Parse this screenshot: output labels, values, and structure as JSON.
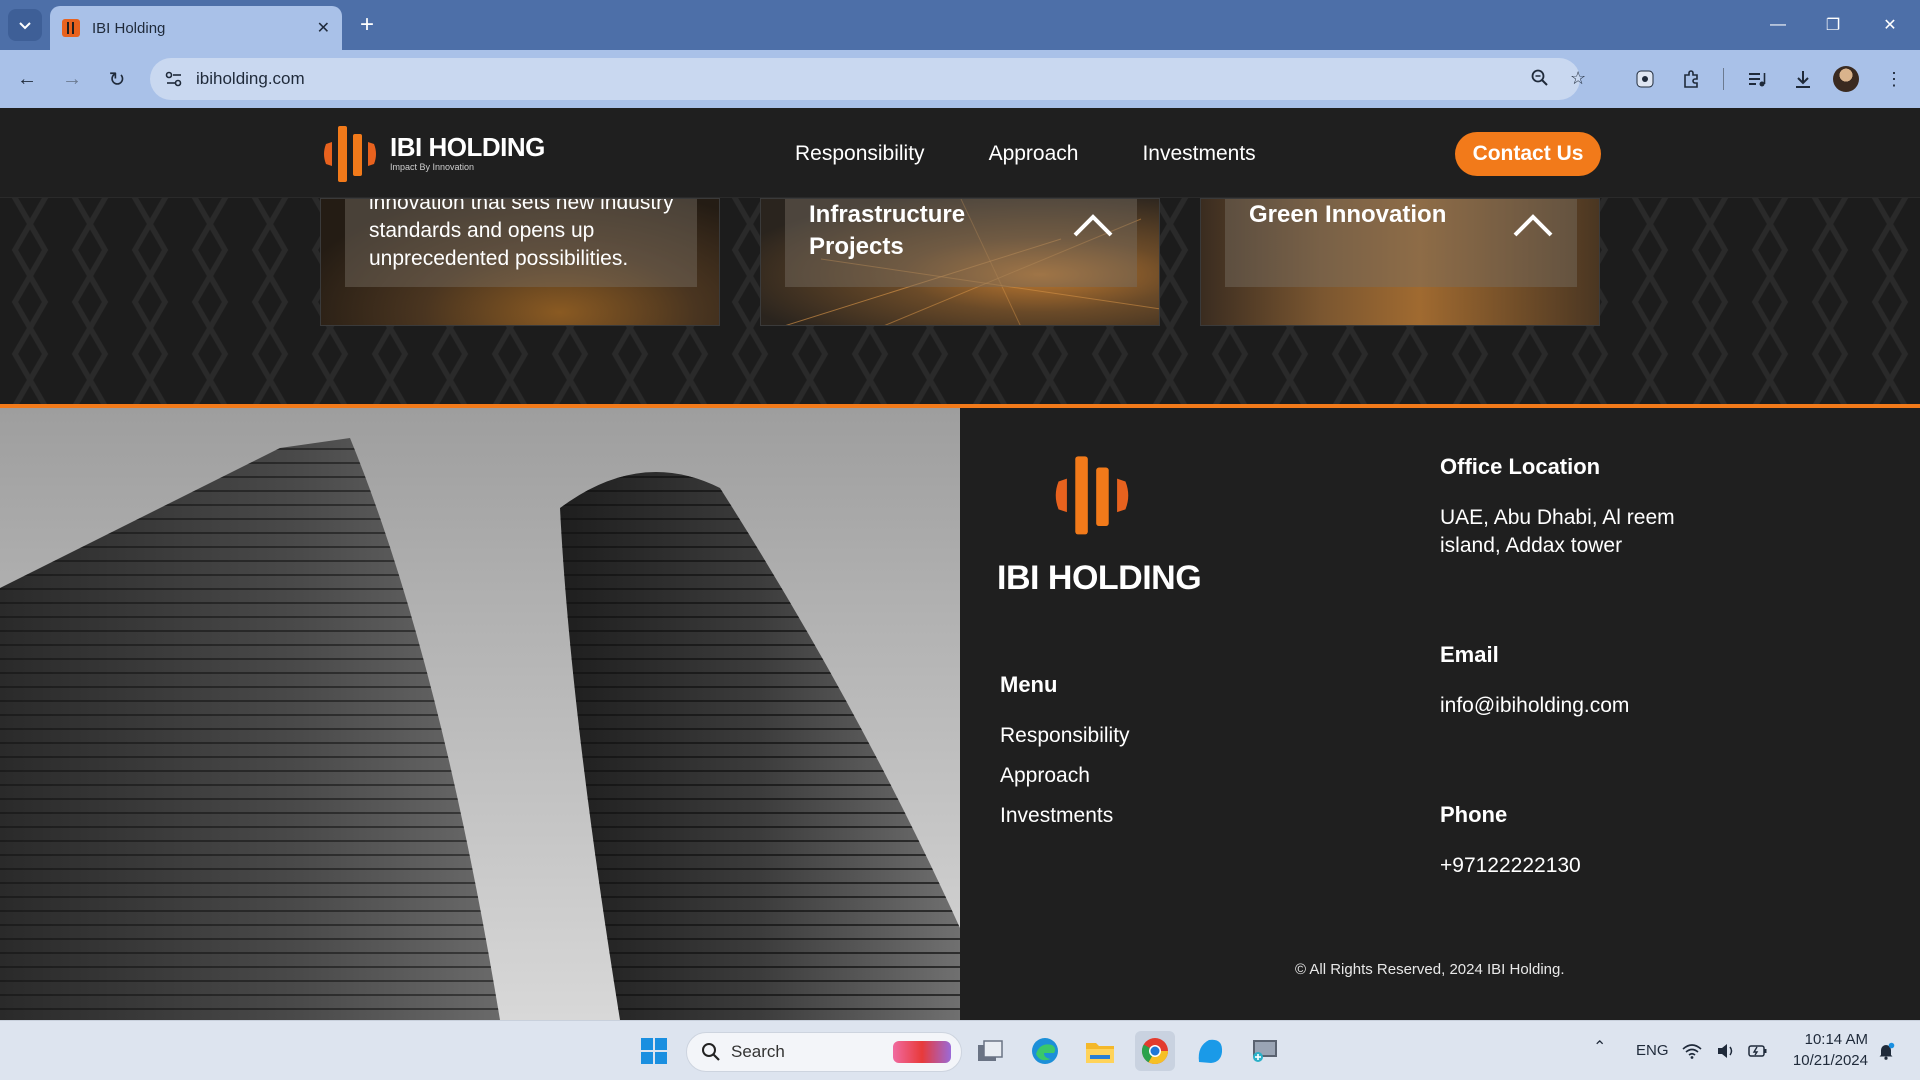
{
  "browser": {
    "tab_title": "IBI Holding",
    "url": "ibiholding.com"
  },
  "site": {
    "logo_name": "IBI HOLDING",
    "logo_tagline": "Impact By Innovation",
    "nav": [
      "Responsibility",
      "Approach",
      "Investments"
    ],
    "contact_label": "Contact Us",
    "brand_color": "#f27a1a"
  },
  "cards": [
    {
      "text": "innovation that sets new industry standards and opens up unprecedented possibilities."
    },
    {
      "title": "Infrastructure Projects"
    },
    {
      "title": "Green Innovation"
    }
  ],
  "footer": {
    "logo_name": "IBI HOLDING",
    "menu_heading": "Menu",
    "menu_items": [
      "Responsibility",
      "Approach",
      "Investments"
    ],
    "office_heading": "Office Location",
    "office_value": "UAE, Abu Dhabi, Al reem island, Addax tower",
    "email_heading": "Email",
    "email_value": "info@ibiholding.com",
    "phone_heading": "Phone",
    "phone_value": "+97122222130",
    "copyright": "© All Rights Reserved, 2024 IBI Holding."
  },
  "taskbar": {
    "search_label": "Search",
    "language": "ENG",
    "time": "10:14 AM",
    "date": "10/21/2024"
  }
}
